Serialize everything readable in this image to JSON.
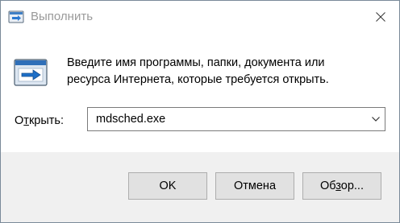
{
  "window": {
    "title": "Выполнить",
    "close_icon": "close-icon"
  },
  "content": {
    "description_line1": "Введите имя программы, папки, документа или",
    "description_line2": "ресурса Интернета, которые требуется открыть.",
    "icon": "run-dialog-icon",
    "open_label_prefix": "О",
    "open_label_underlined": "т",
    "open_label_suffix": "крыть:",
    "open_value": "mdsched.exe"
  },
  "buttons": {
    "ok_label": "OK",
    "cancel_label": "Отмена",
    "browse_prefix": "Об",
    "browse_underlined": "з",
    "browse_suffix": "ор..."
  },
  "colors": {
    "accent": "#2b579a",
    "icon_blue": "#1e6fc7"
  }
}
